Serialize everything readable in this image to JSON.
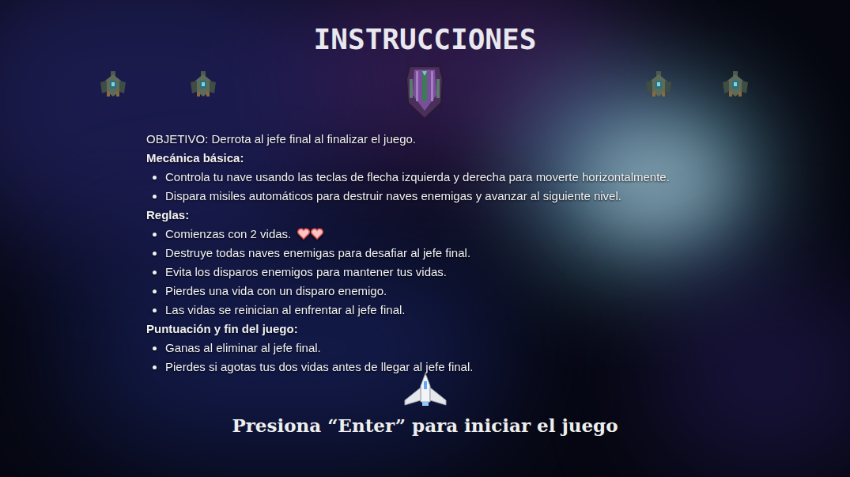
{
  "screen": {
    "title": "INSTRUCCIONES"
  },
  "objective": "OBJETIVO: Derrota al jefe final al finalizar el juego.",
  "sections": [
    {
      "heading": "Mecánica básica:",
      "items": [
        {
          "text": "Controla tu nave usando las teclas de flecha izquierda y derecha para moverte horizontalmente.",
          "hearts": 0
        },
        {
          "text": "Dispara misiles automáticos para destruir naves enemigas y avanzar al siguiente nivel.",
          "hearts": 0
        }
      ]
    },
    {
      "heading": "Reglas:",
      "items": [
        {
          "text": "Comienzas con 2 vidas.",
          "hearts": 2
        },
        {
          "text": "Destruye todas naves enemigas para desafiar al jefe final.",
          "hearts": 0
        },
        {
          "text": "Evita los disparos enemigos para mantener tus vidas.",
          "hearts": 0
        },
        {
          "text": "Pierdes una vida con un disparo enemigo.",
          "hearts": 0
        },
        {
          "text": "Las vidas se reinician al enfrentar al jefe final.",
          "hearts": 0
        }
      ]
    },
    {
      "heading": "Puntuación y fin del juego:",
      "items": [
        {
          "text": "Ganas al eliminar al jefe final.",
          "hearts": 0
        },
        {
          "text": "Pierdes si agotas tus dos vidas antes de llegar al jefe final.",
          "hearts": 0
        }
      ]
    }
  ],
  "prompt": "Presiona “Enter” para iniciar el juego"
}
